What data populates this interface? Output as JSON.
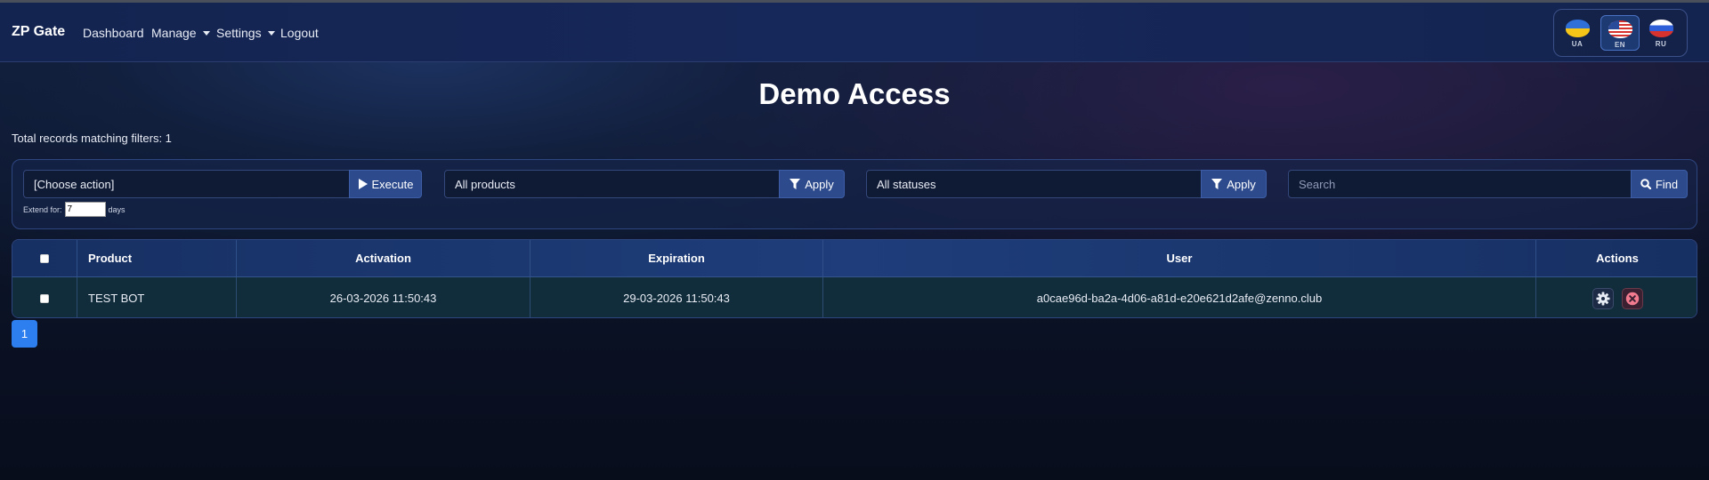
{
  "navbar": {
    "brand": "ZP Gate",
    "links": [
      {
        "label": "Dashboard"
      },
      {
        "label": "Manage"
      },
      {
        "label": "Settings"
      },
      {
        "label": "Logout"
      }
    ],
    "languages": [
      {
        "code": "UA",
        "active": false
      },
      {
        "code": "EN",
        "active": true
      },
      {
        "code": "RU",
        "active": false
      }
    ]
  },
  "page": {
    "title": "Demo Access",
    "total_label": "Total records matching filters: 1"
  },
  "filters": {
    "action_value": "[Choose action]",
    "execute_label": "Execute",
    "extend_label": "Extend for:",
    "extend_value": "7",
    "extend_unit": "days",
    "products_value": "All products",
    "statuses_value": "All statuses",
    "apply_label": "Apply",
    "search_placeholder": "Search",
    "find_label": "Find"
  },
  "table": {
    "headers": [
      "Product",
      "Activation",
      "Expiration",
      "User",
      "Actions"
    ],
    "rows": [
      {
        "product": "TEST BOT",
        "activation": "26-03-2026 11:50:43",
        "expiration": "29-03-2026 11:50:43",
        "user": "a0cae96d-ba2a-4d06-a81d-e20e621d2afe@zenno.club"
      }
    ]
  },
  "pagination": {
    "current": "1"
  },
  "colors": {
    "accent": "#2d7ff0",
    "button": "#2c4a8c",
    "delete": "#f27b8f"
  }
}
